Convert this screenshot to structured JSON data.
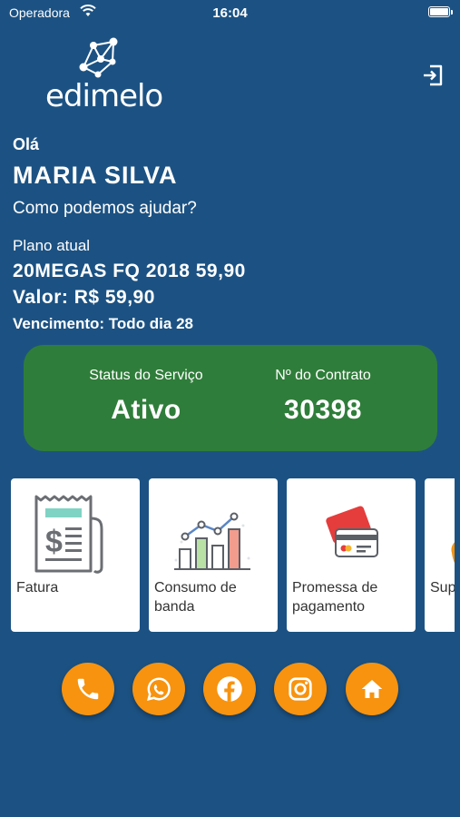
{
  "status_bar": {
    "carrier": "Operadora",
    "time": "16:04"
  },
  "header": {
    "logo_text": "edimelo",
    "logout_icon": "logout-icon"
  },
  "greeting": {
    "hello": "Olá",
    "name": "MARIA SILVA",
    "help": "Como podemos ajudar?"
  },
  "plan": {
    "label": "Plano atual",
    "name": "20MEGAS FQ 2018 59,90",
    "price": "Valor: R$ 59,90",
    "due": "Vencimento: Todo dia 28"
  },
  "service_card": {
    "status_label": "Status do Serviço",
    "status_value": "Ativo",
    "contract_label": "Nº do Contrato",
    "contract_value": "30398"
  },
  "menu": [
    {
      "label": "Fatura",
      "icon": "invoice-icon"
    },
    {
      "label": "Consumo de banda",
      "icon": "bandwidth-chart-icon"
    },
    {
      "label": "Promessa de pagamento",
      "icon": "credit-card-icon"
    },
    {
      "label": "Sup",
      "icon": "support-icon"
    }
  ],
  "social": [
    {
      "name": "phone",
      "icon": "phone-icon"
    },
    {
      "name": "whatsapp",
      "icon": "whatsapp-icon"
    },
    {
      "name": "facebook",
      "icon": "facebook-icon"
    },
    {
      "name": "instagram",
      "icon": "instagram-icon"
    },
    {
      "name": "home",
      "icon": "home-icon"
    }
  ],
  "colors": {
    "background": "#1c5283",
    "status_card": "#2f7d3a",
    "social_button": "#f7930f",
    "card": "#ffffff"
  }
}
